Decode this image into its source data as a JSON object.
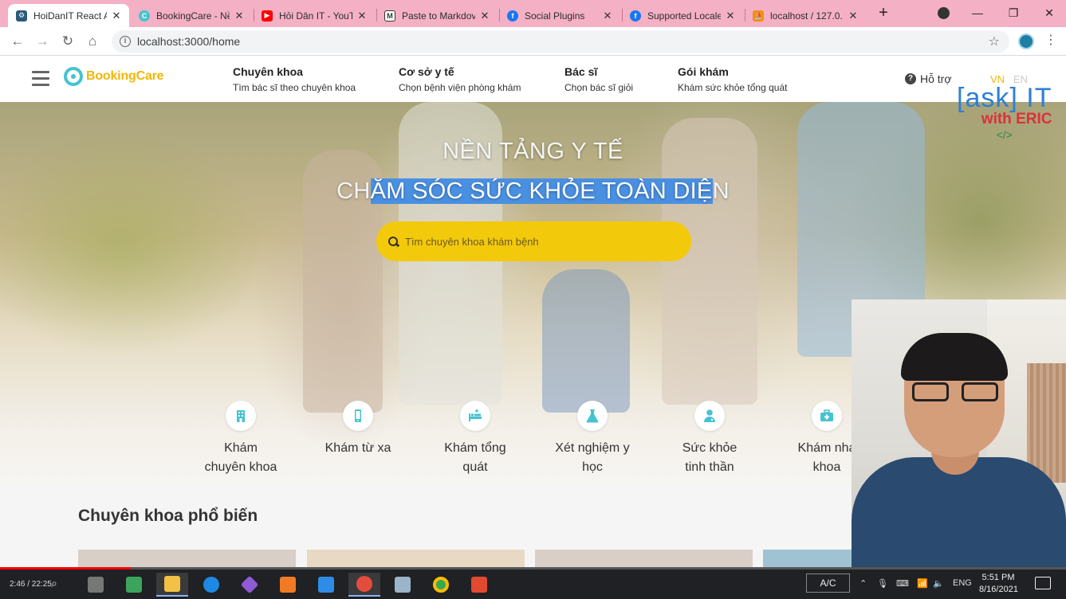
{
  "browser": {
    "tabs": [
      {
        "title": "HoiDanIT React A",
        "icon_color": "#2b5a7a",
        "active": true
      },
      {
        "title": "BookingCare - Nề",
        "icon_color": "#45c3d2",
        "active": false
      },
      {
        "title": "Hỏi Dân IT - YouT",
        "icon_color": "#ff0000",
        "active": false
      },
      {
        "title": "Paste to Markdov",
        "icon_color": "#333333",
        "active": false
      },
      {
        "title": "Social Plugins",
        "icon_color": "#1877f2",
        "active": false
      },
      {
        "title": "Supported Locale",
        "icon_color": "#1877f2",
        "active": false
      },
      {
        "title": "localhost / 127.0.",
        "icon_color": "#f29111",
        "active": false
      }
    ],
    "close_glyph": "✕",
    "new_tab": "+",
    "url": "localhost:3000/home",
    "minimize": "—",
    "restore": "❐",
    "close": "✕"
  },
  "header": {
    "logo": "BookingCare",
    "menu": [
      {
        "title": "Chuyên khoa",
        "sub": "Tìm bác sĩ theo chuyên khoa"
      },
      {
        "title": "Cơ sở y tế",
        "sub": "Chọn bệnh viện phòng khám"
      },
      {
        "title": "Bác sĩ",
        "sub": "Chọn bác sĩ giỏi"
      },
      {
        "title": "Gói khám",
        "sub": "Khám sức khỏe tổng quát"
      }
    ],
    "support": "Hỗ trợ",
    "lang_vn": "VN",
    "lang_en": "EN",
    "lang_active_color": "#f2b705",
    "lang_inactive_color": "#cccccc"
  },
  "hero": {
    "title1": "NỀN TẢNG Y TẾ",
    "title2_prefix": "CH",
    "title2_highlight": "ĂM SÓC SỨC KHỎE TOÀN DIỆ",
    "title2_suffix": "N",
    "search_placeholder": "Tìm chuyên khoa khám bệnh",
    "options": [
      {
        "label_line1": "Khám",
        "label_line2": "chuyên khoa",
        "icon": "hospital-icon"
      },
      {
        "label_line1": "Khám từ xa",
        "label_line2": "",
        "icon": "mobile-phone-icon"
      },
      {
        "label_line1": "Khám tổng",
        "label_line2": "quát",
        "icon": "procedures-bed-icon"
      },
      {
        "label_line1": "Xét nghiệm y",
        "label_line2": "học",
        "icon": "flask-icon"
      },
      {
        "label_line1": "Sức khỏe",
        "label_line2": "tinh thần",
        "icon": "user-md-icon"
      },
      {
        "label_line1": "Khám nha",
        "label_line2": "khoa",
        "icon": "briefcase-medical-icon"
      }
    ],
    "icon_color": "#45c3d2"
  },
  "section": {
    "title": "Chuyên khoa phổ biến"
  },
  "watermark": {
    "line1": "[ask] IT",
    "line2": "with ERIC",
    "line3": "</>"
  },
  "video": {
    "time": "2:46 / 22:25",
    "progress_fraction": 0.123
  },
  "taskbar": {
    "ac_label": "A/C",
    "lang": "ENG",
    "time": "5:51 PM",
    "date": "8/16/2021"
  }
}
